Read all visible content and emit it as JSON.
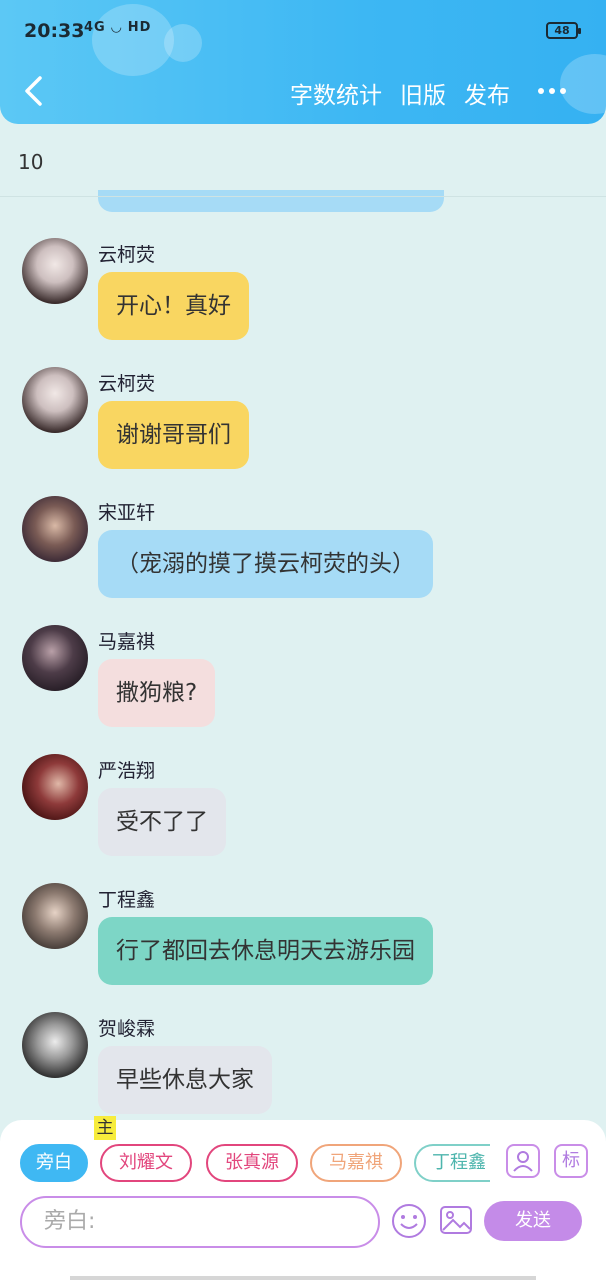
{
  "status_bar": {
    "time": "20:33",
    "network": "4G",
    "hd": "HD",
    "battery": "48"
  },
  "header": {
    "actions": [
      "字数统计",
      "旧版",
      "发布"
    ]
  },
  "word_count": "10",
  "messages": [
    {
      "name": "云柯荧",
      "text": "开心！真好",
      "color": "#f9d661"
    },
    {
      "name": "云柯荧",
      "text": "谢谢哥哥们",
      "color": "#f9d661"
    },
    {
      "name": "宋亚轩",
      "text": "（宠溺的摸了摸云柯荧的头）",
      "color": "#a6dbf6"
    },
    {
      "name": "马嘉祺",
      "text": "撒狗粮?",
      "color": "#f4dede"
    },
    {
      "name": "严浩翔",
      "text": "受不了了",
      "color": "#e3e6ec"
    },
    {
      "name": "丁程鑫",
      "text": "行了都回去休息明天去游乐园",
      "color": "#7dd6c6"
    },
    {
      "name": "贺峻霖",
      "text": "早些休息大家",
      "color": "#e3e6ec"
    }
  ],
  "composer": {
    "roles": [
      "旁白",
      "刘耀文",
      "张真源",
      "马嘉祺",
      "丁程鑫"
    ],
    "host_tag": "主",
    "mark_label": "标",
    "placeholder": "旁白:",
    "send_label": "发送"
  }
}
